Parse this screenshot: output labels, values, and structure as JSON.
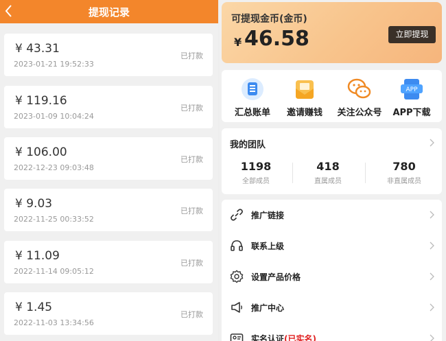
{
  "left": {
    "title": "提现记录",
    "records": [
      {
        "amount": "¥ 43.31",
        "date": "2023-01-21 19:52:33",
        "status": "已打款"
      },
      {
        "amount": "¥ 119.16",
        "date": "2023-01-09 10:04:24",
        "status": "已打款"
      },
      {
        "amount": "¥ 106.00",
        "date": "2022-12-23 09:03:48",
        "status": "已打款"
      },
      {
        "amount": "¥ 9.03",
        "date": "2022-11-25 00:33:52",
        "status": "已打款"
      },
      {
        "amount": "¥ 11.09",
        "date": "2022-11-14 09:05:12",
        "status": "已打款"
      },
      {
        "amount": "¥ 1.45",
        "date": "2022-11-03 13:34:56",
        "status": "已打款"
      }
    ]
  },
  "right": {
    "coin": {
      "label": "可提现金币(金币)",
      "currency": "¥",
      "amount": "46.58",
      "button": "立即提现"
    },
    "quick": [
      {
        "label": "汇总账单",
        "icon": "bill-icon"
      },
      {
        "label": "邀请赚钱",
        "icon": "invite-envelope-icon"
      },
      {
        "label": "关注公众号",
        "icon": "wechat-icon"
      },
      {
        "label": "APP下载",
        "icon": "app-download-icon"
      }
    ],
    "team": {
      "title": "我的团队",
      "stats": [
        {
          "value": "1198",
          "label": "全部成员"
        },
        {
          "value": "418",
          "label": "直属成员"
        },
        {
          "value": "780",
          "label": "非直属成员"
        }
      ]
    },
    "menu": [
      {
        "label": "推广链接",
        "icon": "link-icon"
      },
      {
        "label": "联系上级",
        "icon": "headset-icon"
      },
      {
        "label": "设置产品价格",
        "icon": "gear-icon"
      },
      {
        "label": "推广中心",
        "icon": "megaphone-icon"
      },
      {
        "label": "实名认证",
        "note": "(已实名)",
        "icon": "id-card-icon"
      }
    ]
  },
  "colors": {
    "header": "#f3862b",
    "coin_card": "#f8c48c",
    "withdraw_button": "#3a3028",
    "accent_red": "#e02020"
  }
}
